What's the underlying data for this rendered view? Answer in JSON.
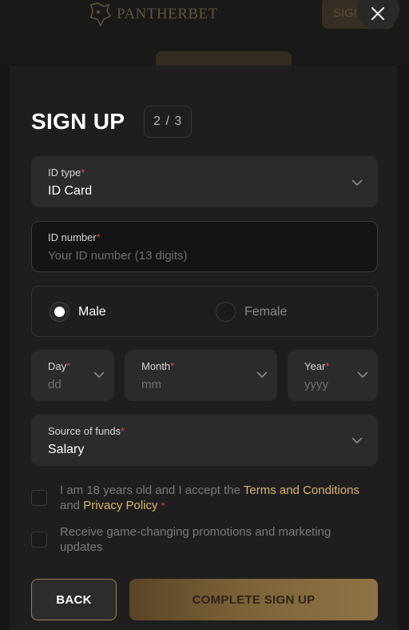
{
  "background": {
    "logo_text": "PANTHERBET",
    "header_button_label": "SIGN"
  },
  "modal": {
    "title": "SIGN UP",
    "step": "2 / 3",
    "id_type": {
      "label": "ID type",
      "required_mark": "*",
      "value": "ID Card"
    },
    "id_number": {
      "label": "ID number",
      "required_mark": "*",
      "placeholder": "Your ID number (13 digits)",
      "value": ""
    },
    "gender": {
      "options": [
        {
          "label": "Male",
          "selected": true
        },
        {
          "label": "Female",
          "selected": false
        }
      ]
    },
    "birth_date": {
      "day": {
        "label": "Day",
        "required_mark": "*",
        "placeholder": "dd"
      },
      "month": {
        "label": "Month",
        "required_mark": "*",
        "placeholder": "mm"
      },
      "year": {
        "label": "Year",
        "required_mark": "*",
        "placeholder": "yyyy"
      }
    },
    "source_of_funds": {
      "label": "Source of funds",
      "required_mark": "*",
      "value": "Salary"
    },
    "terms_checkbox": {
      "text_before": "I am 18 years old and I accept the ",
      "terms_link": "Terms and Conditions",
      "text_middle": " and ",
      "privacy_link": "Privacy Policy",
      "required_mark": "*",
      "checked": false
    },
    "promotions_checkbox": {
      "text": "Receive game-changing promotions and marketing updates",
      "checked": false
    },
    "back_label": "BACK",
    "complete_label": "COMPLETE SIGN UP"
  },
  "colors": {
    "accent_gold": "#d9b472",
    "required_red": "#e0463a",
    "modal_bg": "#1e1e1e",
    "field_bg": "#2b2b2b"
  },
  "icons": [
    "panther-logo-icon",
    "close-icon",
    "chevron-down-icon"
  ]
}
